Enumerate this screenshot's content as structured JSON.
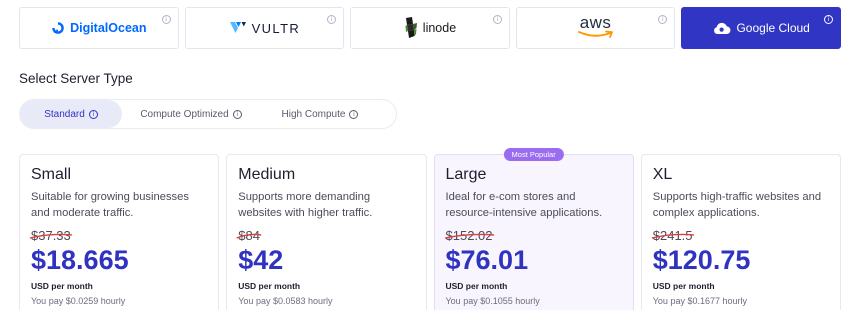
{
  "providers": [
    {
      "name": "DigitalOcean",
      "selected": false
    },
    {
      "name": "VULTR",
      "selected": false
    },
    {
      "name": "linode",
      "selected": false
    },
    {
      "name": "aws",
      "selected": false
    },
    {
      "name": "Google Cloud",
      "selected": true
    }
  ],
  "info_glyph": "i",
  "section_title": "Select Server Type",
  "server_types": [
    {
      "label": "Standard",
      "active": true
    },
    {
      "label": "Compute Optimized",
      "active": false
    },
    {
      "label": "High Compute",
      "active": false
    }
  ],
  "plans": [
    {
      "name": "Small",
      "description": "Suitable for growing businesses and moderate traffic.",
      "old_price": "$37.33",
      "price": "$18.665",
      "period": "USD per month",
      "hourly": "You pay $0.0259 hourly"
    },
    {
      "name": "Medium",
      "description": "Supports more demanding websites with higher traffic.",
      "old_price": "$84",
      "price": "$42",
      "period": "USD per month",
      "hourly": "You pay $0.0583 hourly"
    },
    {
      "name": "Large",
      "badge": "Most Popular",
      "description": "Ideal for e-com stores and resource-intensive applications.",
      "old_price": "$152.02",
      "price": "$76.01",
      "period": "USD per month",
      "hourly": "You pay $0.1055 hourly"
    },
    {
      "name": "XL",
      "description": "Supports high-traffic websites and complex applications.",
      "old_price": "$241.5",
      "price": "$120.75",
      "period": "USD per month",
      "hourly": "You pay $0.1677 hourly"
    }
  ],
  "colors": {
    "accent": "#3035c4",
    "price": "#2f33bf",
    "badge": "#9a6cf0",
    "strike": "#e0403a",
    "digitalocean": "#0069ff",
    "aws_smile": "#ff9900"
  },
  "icons": {
    "digitalocean": "digitalocean-logo-icon",
    "vultr": "vultr-logo-icon",
    "linode": "linode-logo-icon",
    "aws": "aws-smile-icon",
    "google_cloud": "cloud-icon",
    "info": "info-icon"
  }
}
